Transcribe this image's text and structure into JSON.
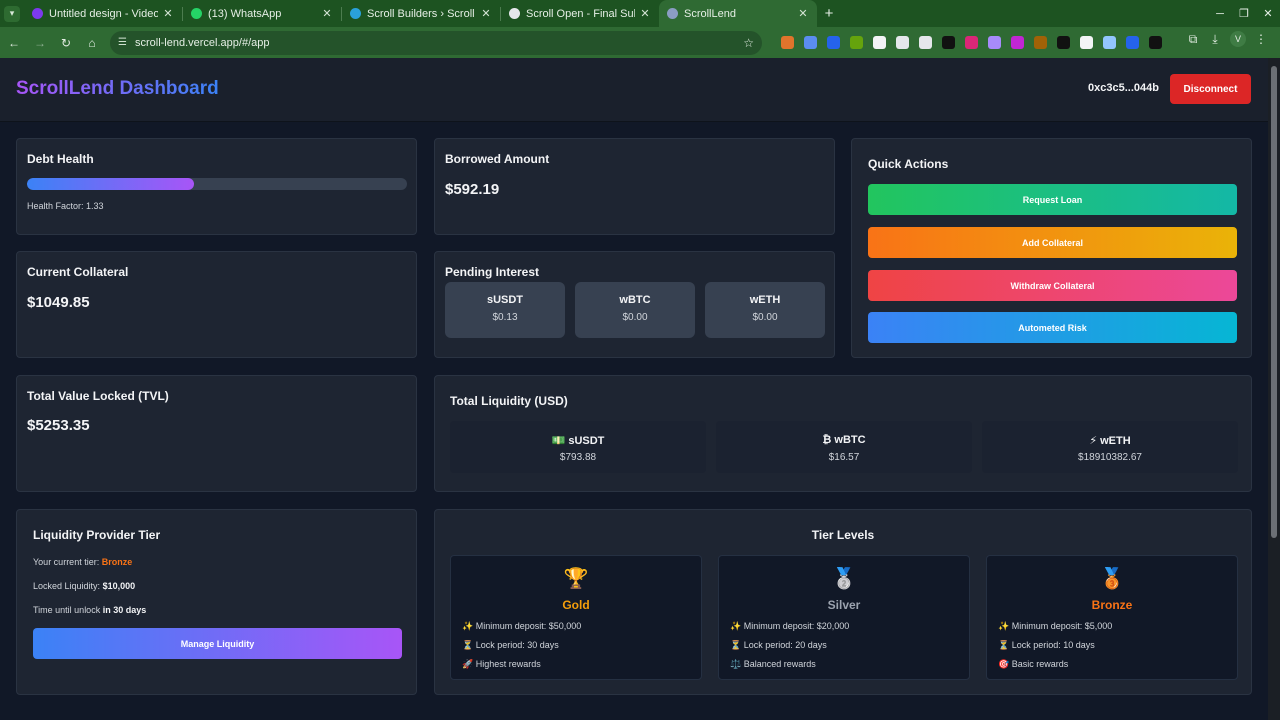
{
  "browser": {
    "tabs": [
      {
        "title": "Untitled design - Video",
        "color": "#7c3aed"
      },
      {
        "title": "(13) WhatsApp",
        "color": "#25d366"
      },
      {
        "title": "Scroll Builders › Scroll Op",
        "color": "#2aa1da"
      },
      {
        "title": "Scroll Open - Final Subm",
        "color": "#e5e7eb"
      },
      {
        "title": "ScrollLend",
        "color": "#8b9dc3"
      }
    ],
    "url": "scroll-lend.vercel.app/#/app",
    "profile_initial": "V",
    "extension_colors": [
      "#e0742c",
      "#5b8def",
      "#2563eb",
      "#65a30d",
      "#f3f4f6",
      "#e5e7eb",
      "#e5e7eb",
      "#111111",
      "#db2777",
      "#a78bfa",
      "#c026d3",
      "#a16207",
      "#111111",
      "#f3f4f6",
      "#93c5fd",
      "#2563eb",
      "#111111"
    ]
  },
  "header": {
    "title": "ScrollLend Dashboard",
    "wallet": "0xc3c5...044b",
    "disconnect_label": "Disconnect"
  },
  "debt_health": {
    "title": "Debt Health",
    "fill_percent": 44,
    "health_factor_text": "Health Factor: 1.33"
  },
  "borrowed": {
    "title": "Borrowed Amount",
    "value": "$592.19"
  },
  "quick_actions": {
    "title": "Quick Actions",
    "buttons": [
      {
        "label": "Request Loan",
        "gradient": "linear-gradient(90deg, #22c55e, #14b8a6)"
      },
      {
        "label": "Add Collateral",
        "gradient": "linear-gradient(90deg, #f97316, #eab308)"
      },
      {
        "label": "Withdraw Collateral",
        "gradient": "linear-gradient(90deg, #ef4444, #ec4899)"
      },
      {
        "label": "Autometed Risk",
        "gradient": "linear-gradient(90deg, #3b82f6, #06b6d4)"
      }
    ]
  },
  "collateral": {
    "title": "Current Collateral",
    "value": "$1049.85"
  },
  "pending_interest": {
    "title": "Pending Interest",
    "items": [
      {
        "token": "sUSDT",
        "amount": "$0.13"
      },
      {
        "token": "wBTC",
        "amount": "$0.00"
      },
      {
        "token": "wETH",
        "amount": "$0.00"
      }
    ]
  },
  "tvl": {
    "title": "Total Value Locked (TVL)",
    "value": "$5253.35"
  },
  "total_liquidity": {
    "title": "Total Liquidity (USD)",
    "items": [
      {
        "token": "💵 sUSDT",
        "amount": "$793.88"
      },
      {
        "token": "₿ wBTC",
        "amount": "$16.57"
      },
      {
        "token": "⚡ wETH",
        "amount": "$18910382.67"
      }
    ]
  },
  "lp_tier": {
    "title": "Liquidity Provider Tier",
    "current_tier_label": "Your current tier:",
    "current_tier": "Bronze",
    "locked_label": "Locked Liquidity:",
    "locked_value": "$10,000",
    "unlock_label": "Time until unlock",
    "unlock_value": "in 30 days",
    "manage_label": "Manage Liquidity"
  },
  "tier_levels": {
    "title": "Tier Levels",
    "tiers": [
      {
        "medal": "🏆",
        "name": "Gold",
        "color": "#f59e0b",
        "features": [
          "✨ Minimum deposit: $50,000",
          "⏳ Lock period: 30 days",
          "🚀 Highest rewards"
        ]
      },
      {
        "medal": "🥈",
        "name": "Silver",
        "color": "#9ca3af",
        "features": [
          "✨ Minimum deposit: $20,000",
          "⏳ Lock period: 20 days",
          "⚖️ Balanced rewards"
        ]
      },
      {
        "medal": "🥉",
        "name": "Bronze",
        "color": "#f97316",
        "features": [
          "✨ Minimum deposit: $5,000",
          "⏳ Lock period: 10 days",
          "🎯 Basic rewards"
        ]
      }
    ]
  }
}
